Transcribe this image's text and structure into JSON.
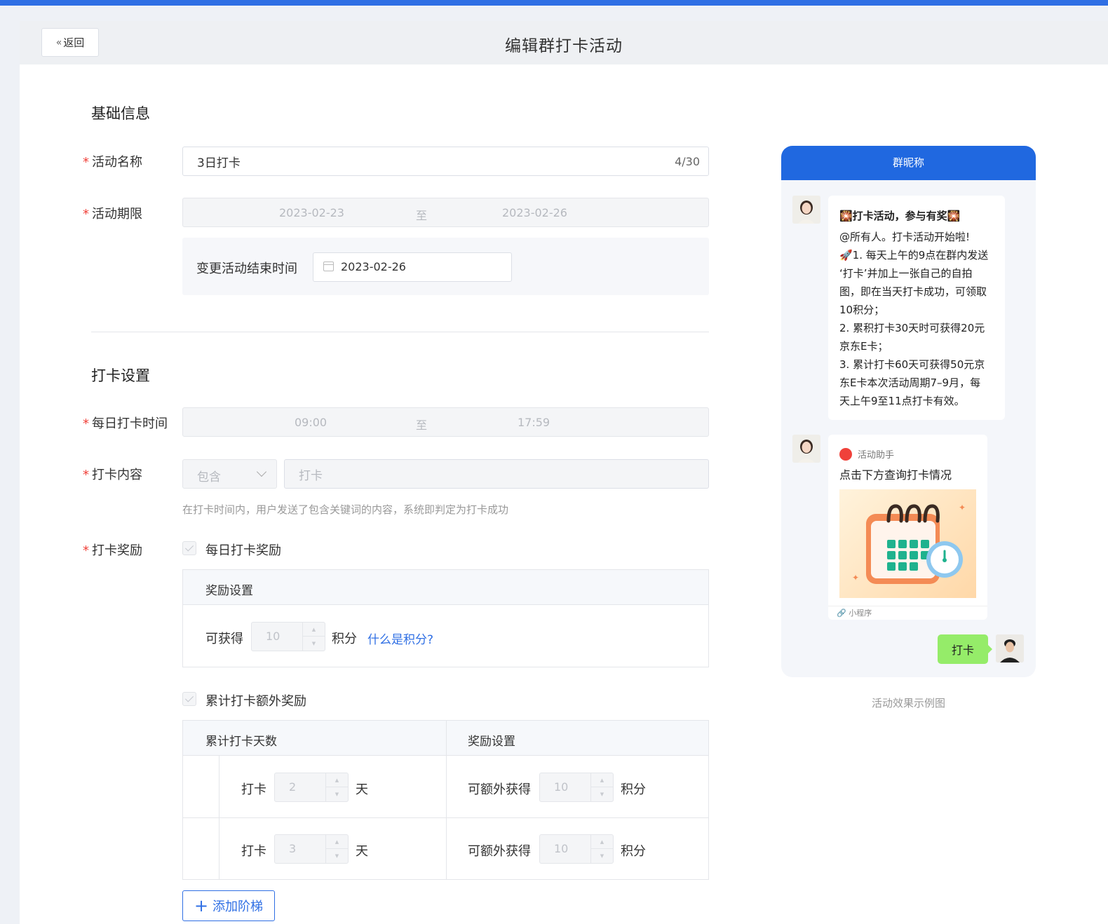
{
  "header": {
    "back_label": "返回",
    "title": "编辑群打卡活动"
  },
  "basic": {
    "section_title": "基础信息",
    "name_label": "活动名称",
    "name_value": "3日打卡",
    "name_count": "4/30",
    "period_label": "活动期限",
    "period_start": "2023-02-23",
    "period_sep": "至",
    "period_end": "2023-02-26",
    "end_change_label": "变更活动结束时间",
    "end_change_value": "2023-02-26"
  },
  "checkin": {
    "section_title": "打卡设置",
    "time_label": "每日打卡时间",
    "time_start": "09:00",
    "time_sep": "至",
    "time_end": "17:59",
    "content_label": "打卡内容",
    "content_mode": "包含",
    "content_keyword_placeholder": "打卡",
    "content_hint": "在打卡时间内，用户发送了包含关键词的内容，系统即判定为打卡成功",
    "reward_label": "打卡奖励",
    "daily_reward_label": "每日打卡奖励",
    "daily_table_header": "奖励设置",
    "daily_earn_label": "可获得",
    "daily_points": "10",
    "points_unit": "积分",
    "what_is_points": "什么是积分?",
    "cumulative_reward_label": "累计打卡额外奖励",
    "cum_col_days": "累计打卡天数",
    "cum_col_reward": "奖励设置",
    "rows": [
      {
        "prefix": "打卡",
        "days": "2",
        "day_unit": "天",
        "extra_label": "可额外获得",
        "points": "10",
        "points_unit": "积分"
      },
      {
        "prefix": "打卡",
        "days": "3",
        "day_unit": "天",
        "extra_label": "可额外获得",
        "points": "10",
        "points_unit": "积分"
      }
    ],
    "add_tier_label": "添加阶梯"
  },
  "preview": {
    "header": "群昵称",
    "message_title": "🎇打卡活动，参与有奖🎇",
    "message_lines": [
      "@所有人。打卡活动开始啦!",
      "🚀1. 每天上午的9点在群内发送",
      "‘打卡’并加上一张自己的自拍",
      "图，即在当天打卡成功，可领取",
      "10积分；",
      "2. 累积打卡30天时可获得20元",
      "京东E卡；",
      "3. 累计打卡60天可获得50元京",
      "东E卡本次活动周期7–9月，每",
      "天上午9至11点打卡有效。"
    ],
    "mini_app_name": "活动助手",
    "mini_title": "点击下方查询打卡情况",
    "mini_footer": "小程序",
    "reply": "打卡",
    "caption": "活动效果示例图"
  }
}
